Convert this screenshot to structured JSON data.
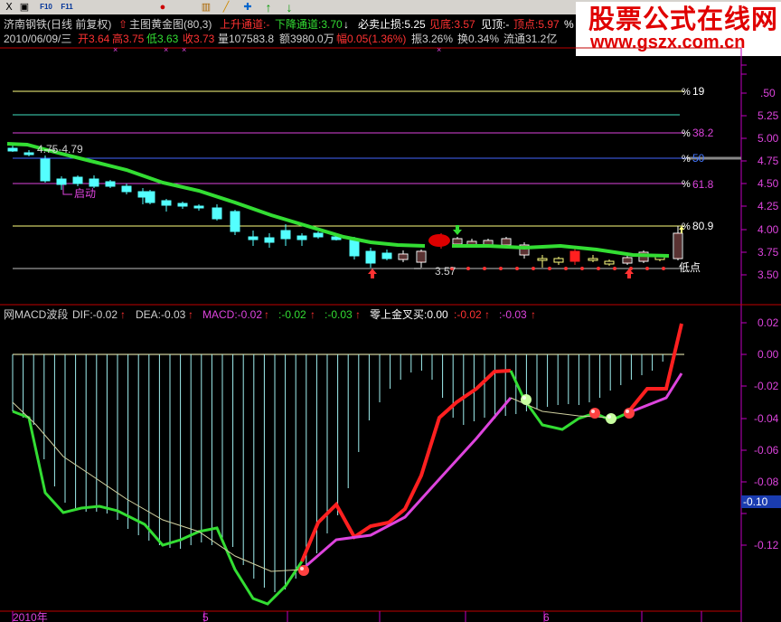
{
  "toolbar": {
    "buttons": [
      {
        "name": "chart-toggle-icon",
        "label": "Ⅹ"
      },
      {
        "name": "zoom-icon",
        "label": "▣"
      },
      {
        "name": "f10-icon",
        "label": "F10"
      },
      {
        "name": "f11-icon",
        "label": "F11"
      },
      {
        "name": "stop-icon",
        "label": "●"
      },
      {
        "name": "chart-icon",
        "label": "▥"
      },
      {
        "name": "draw-line-icon",
        "label": "╱"
      },
      {
        "name": "cross-move-icon",
        "label": "✚"
      },
      {
        "name": "arrow-up-icon",
        "label": "↑"
      },
      {
        "name": "arrow-down-icon",
        "label": "↓"
      }
    ]
  },
  "header": {
    "stock": "济南钢铁(日线 前复权)",
    "indicator": "主图黄金图(80,3)",
    "upper_channel": "上升通道:-",
    "lower_channel": "下降通道:3.70",
    "must_sell": "必卖止损:5.25",
    "bottom": "见底:3.57",
    "top": "见顶:-",
    "peak": "顶点:5.97",
    "pct": "%",
    "date": "2010/06/09/三",
    "open": "开3.64",
    "high": "高3.75",
    "low": "低3.63",
    "close": "收3.73",
    "volume": "量107583.8",
    "amount": "额3980.0万",
    "change": "幅0.05(1.36%)",
    "amplitude": "振3.26%",
    "turnover": "换0.34%",
    "float": "流通31.2亿"
  },
  "ad": {
    "title": "股票公式在线网",
    "url": "www.gszx.com.cn"
  },
  "main_chart": {
    "range_label": "4.75-4.79",
    "start_label": "启动",
    "low_label": "3.57",
    "bottom_point": "低点",
    "fib_labels": [
      "19",
      "38.2",
      "50",
      "61.8",
      "80.9"
    ],
    "price_ticks": [
      ".50",
      "5.25",
      "5.00",
      "4.75",
      "4.50",
      "4.25",
      "4.00",
      "3.75",
      "3.50"
    ]
  },
  "macd": {
    "name": "网MACD波段",
    "dif": "DIF:-0.02",
    "dea": "DEA:-0.03",
    "macd": "MACD:-0.02",
    "v1": ":-0.02",
    "v2": ":-0.03",
    "zero_cross": "零上金叉买:0.00",
    "v3": ":-0.02",
    "v4": ":-0.03",
    "ticks": [
      "0.02",
      "0.00",
      "-0.02",
      "-0.04",
      "-0.06",
      "-0.08",
      "-0.10",
      "-0.12"
    ],
    "highlight_tick": "-0.10"
  },
  "time_axis": {
    "labels": [
      "2010年",
      "5",
      "6"
    ]
  },
  "colors": {
    "bull": "#ff3232",
    "bear": "#54ffff",
    "ma": "#33dd33",
    "dea": "#dd44dd",
    "axis": "#c000c0",
    "grid": "#ffff80"
  }
}
